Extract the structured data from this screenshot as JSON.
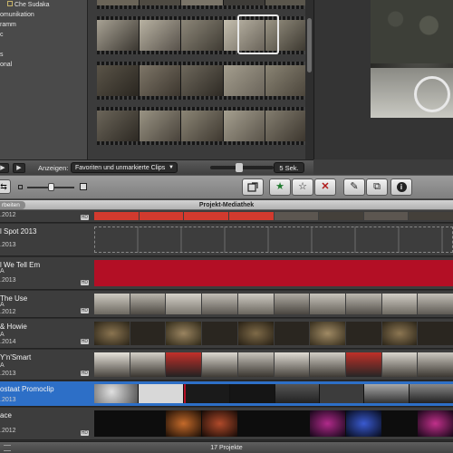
{
  "event_library": {
    "items": [
      {
        "label": "Che Sudaka"
      },
      {
        "label": "omunikation"
      },
      {
        "label": "ramm"
      },
      {
        "label": "c"
      },
      {
        "label": ""
      },
      {
        "label": "s"
      },
      {
        "label": "onal"
      }
    ]
  },
  "browser": {
    "show_label": "Anzeigen:",
    "filter_value": "Favoriten und unmarkierte Clips",
    "duration_value": "5 Sek.",
    "play_full_label": "▶",
    "play_label": "▶"
  },
  "toolbar": {
    "add_to_project_icon": "add-to-project-icon",
    "favorite_icon": "★",
    "unmark_icon": "☆",
    "reject_icon": "✕",
    "keyword_icon": "✎",
    "crop_icon": "⧉",
    "info_icon": "i"
  },
  "project_library": {
    "back_label": "rbeiten",
    "title": "Projekt-Mediathek",
    "projects": [
      {
        "name": "",
        "sub": ".2012",
        "sub2": ""
      },
      {
        "name": "l Spot 2013",
        "sub": ".2013",
        "sub2": ""
      },
      {
        "name": "l We Tell Em",
        "sub": "A",
        "sub2": ".2013"
      },
      {
        "name": "The Use",
        "sub": "A",
        "sub2": ".2012"
      },
      {
        "name": "& Howie",
        "sub": "A",
        "sub2": ".2014"
      },
      {
        "name": "Y'n'Smart",
        "sub": "A",
        "sub2": ".2013"
      },
      {
        "name": "ostaat Promoclip",
        "sub": ".2013",
        "sub2": ""
      },
      {
        "name": "ace",
        "sub": ".2012",
        "sub2": ""
      }
    ],
    "count_label": "17 Projekte"
  },
  "colors": {
    "selection": "#2d6fc7",
    "red_clip": "#b30f25",
    "red_strip": "#d23a2e"
  }
}
